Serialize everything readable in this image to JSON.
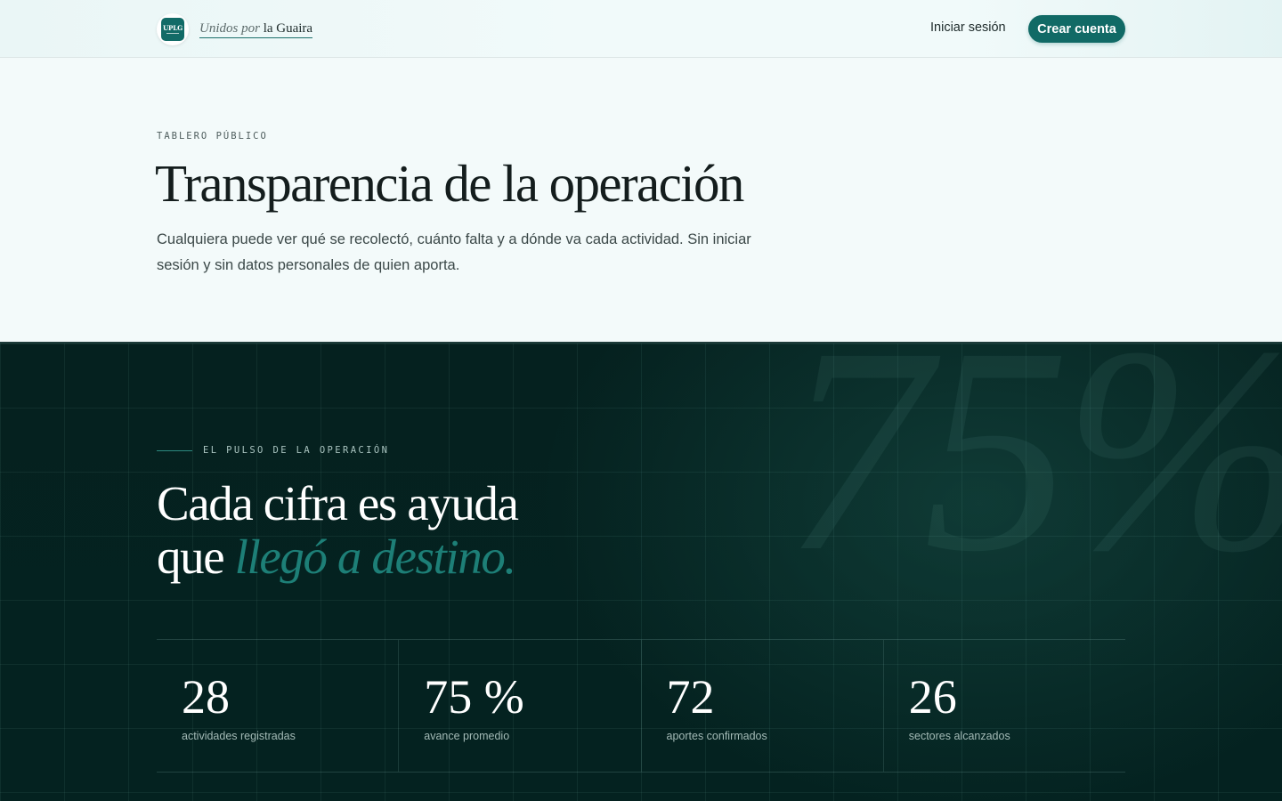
{
  "header": {
    "logo_text": "UPLG",
    "brand_italic": "Unidos por",
    "brand_regular": "la Guaira",
    "login_label": "Iniciar sesión",
    "signup_label": "Crear cuenta"
  },
  "hero": {
    "eyebrow": "TABLERO PÚBLICO",
    "title": "Transparencia de la operación",
    "lead": "Cualquiera puede ver qué se recolectó, cuánto falta y a dónde va cada actividad. Sin iniciar sesión y sin datos personales de quien aporta."
  },
  "pulse": {
    "watermark": "75%",
    "eyebrow": "EL PULSO DE LA OPERACIÓN",
    "title_line1": "Cada cifra es ayuda",
    "title_line2_prefix": "que",
    "title_line2_accent": "llegó a destino.",
    "stats": [
      {
        "value": "28",
        "label": "actividades registradas"
      },
      {
        "value": "75 %",
        "label": "avance promedio"
      },
      {
        "value": "72",
        "label": "aportes confirmados"
      },
      {
        "value": "26",
        "label": "sectores alcanzados"
      }
    ]
  },
  "colors": {
    "brand": "#116a66",
    "dark_bg": "#05211f",
    "accent_text": "#1d7f77",
    "page_bg": "#f3fafa"
  }
}
